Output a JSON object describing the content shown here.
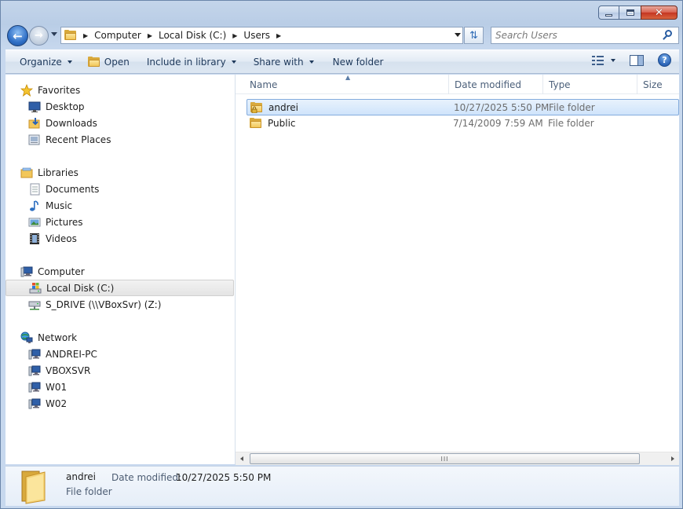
{
  "window": {
    "controls": {
      "minimize": "minimize",
      "maximize": "maximize",
      "close": "✕"
    }
  },
  "nav": {
    "breadcrumb": [
      "Computer",
      "Local Disk (C:)",
      "Users"
    ],
    "search_placeholder": "Search Users"
  },
  "toolbar": {
    "organize": "Organize",
    "open": "Open",
    "include_in_library": "Include in library",
    "share_with": "Share with",
    "new_folder": "New folder",
    "help": "?"
  },
  "sidebar": {
    "favorites": {
      "label": "Favorites",
      "items": [
        "Desktop",
        "Downloads",
        "Recent Places"
      ]
    },
    "libraries": {
      "label": "Libraries",
      "items": [
        "Documents",
        "Music",
        "Pictures",
        "Videos"
      ]
    },
    "computer": {
      "label": "Computer",
      "items": [
        "Local Disk (C:)",
        "S_DRIVE (\\\\VBoxSvr) (Z:)"
      ],
      "selected": "Local Disk (C:)"
    },
    "network": {
      "label": "Network",
      "items": [
        "ANDREI-PC",
        "VBOXSVR",
        "W01",
        "W02"
      ]
    }
  },
  "file_list": {
    "columns": [
      "Name",
      "Date modified",
      "Type",
      "Size"
    ],
    "rows": [
      {
        "name": "andrei",
        "date": "10/27/2025 5:50 PM",
        "type": "File folder",
        "selected": true
      },
      {
        "name": "Public",
        "date": "7/14/2009 7:59 AM",
        "type": "File folder",
        "selected": false
      }
    ],
    "scroll_thumb": "III"
  },
  "details": {
    "name": "andrei",
    "type": "File folder",
    "date_label": "Date modified:",
    "date_value": "10/27/2025 5:50 PM"
  },
  "colors": {
    "chrome": "#c4d5ea",
    "selection": "#cfe4fb",
    "selection_border": "#84acdd",
    "folder": "#f2c75a"
  }
}
